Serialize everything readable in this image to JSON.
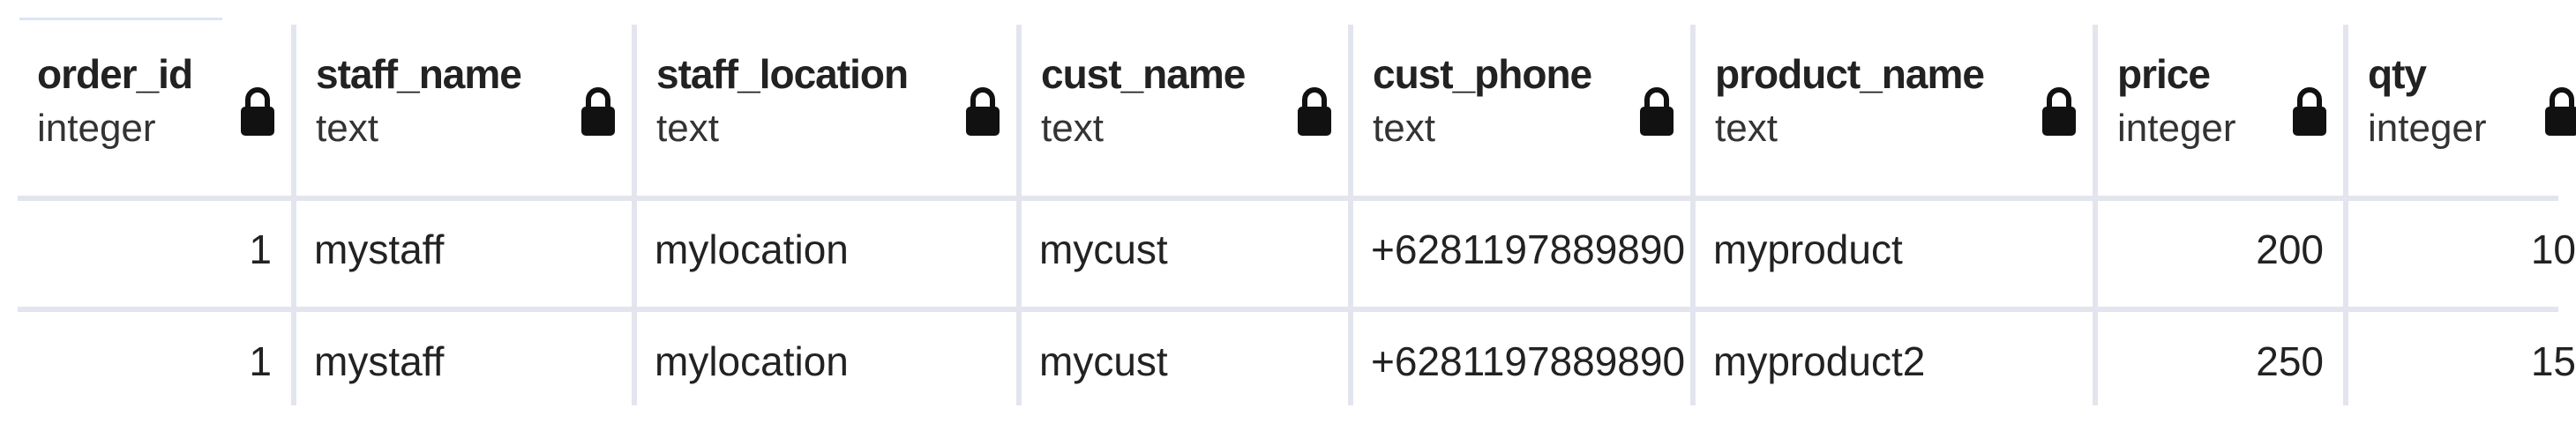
{
  "table": {
    "columns": [
      {
        "name": "order_id",
        "type": "integer"
      },
      {
        "name": "staff_name",
        "type": "text"
      },
      {
        "name": "staff_location",
        "type": "text"
      },
      {
        "name": "cust_name",
        "type": "text"
      },
      {
        "name": "cust_phone",
        "type": "text"
      },
      {
        "name": "product_name",
        "type": "text"
      },
      {
        "name": "price",
        "type": "integer"
      },
      {
        "name": "qty",
        "type": "integer"
      }
    ],
    "rows": [
      [
        "1",
        "mystaff",
        "mylocation",
        "mycust",
        "+6281197889890",
        "myproduct",
        "200",
        "10"
      ],
      [
        "1",
        "mystaff",
        "mylocation",
        "mycust",
        "+6281197889890",
        "myproduct2",
        "250",
        "15"
      ]
    ],
    "lock_icon": "lock-icon",
    "colors": {
      "grid_line": "#e3e5ee",
      "text": "#222222",
      "icon": "#111111"
    }
  }
}
